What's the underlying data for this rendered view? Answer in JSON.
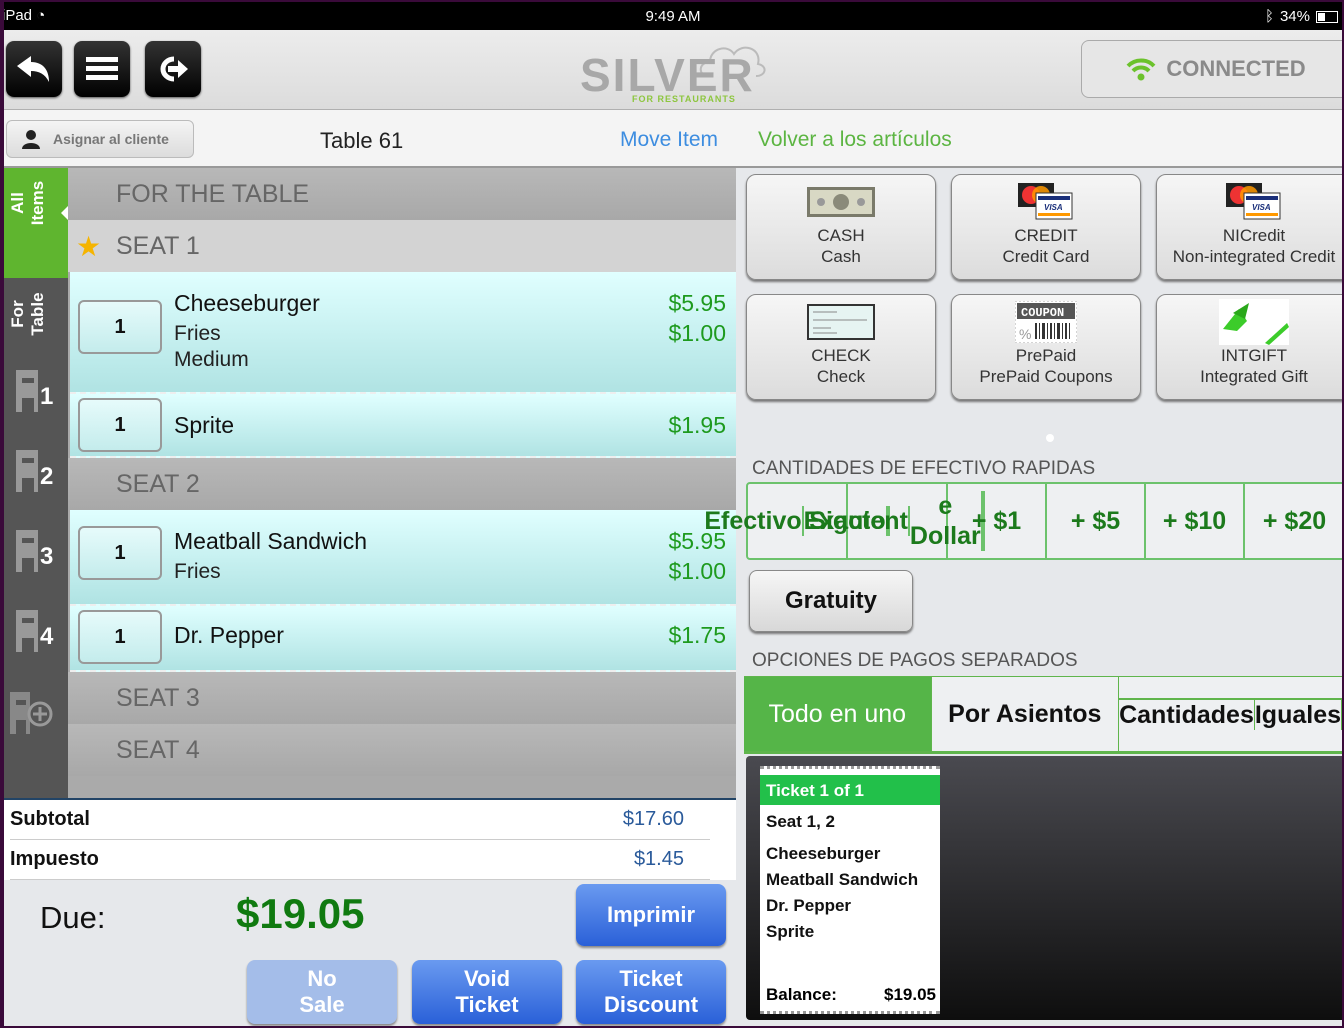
{
  "status_bar": {
    "device": "iPad",
    "time": "9:49 AM",
    "battery": "34%"
  },
  "header": {
    "logo_main": "SILVER",
    "logo_sub": "FOR RESTAURANTS",
    "connection_status": "CONNECTED",
    "back_icon": "back-arrow-icon",
    "menu_icon": "hamburger-menu-icon",
    "logout_icon": "logout-icon"
  },
  "subheader": {
    "assign_label": "Asignar al cliente",
    "table_name": "Table 61",
    "move_item": "Move Item",
    "back_to_items": "Volver a los artículos"
  },
  "side_tabs": {
    "all_items": [
      "All",
      "Items"
    ],
    "for_table": [
      "For",
      "Table"
    ],
    "seats": [
      "1",
      "2",
      "3",
      "4"
    ]
  },
  "order": {
    "sections": [
      {
        "title": "FOR THE TABLE",
        "items": []
      },
      {
        "title": "SEAT 1",
        "starred": true,
        "items": [
          {
            "qty": "1",
            "name": "Cheeseburger",
            "price": "$5.95",
            "modifiers": [
              {
                "name": "Fries",
                "price": "$1.00"
              },
              {
                "name": "Medium",
                "price": ""
              }
            ]
          },
          {
            "qty": "1",
            "name": "Sprite",
            "price": "$1.95",
            "modifiers": []
          }
        ]
      },
      {
        "title": "SEAT 2",
        "items": [
          {
            "qty": "1",
            "name": "Meatball Sandwich",
            "price": "$5.95",
            "modifiers": [
              {
                "name": "Fries",
                "price": "$1.00"
              }
            ]
          },
          {
            "qty": "1",
            "name": "Dr. Pepper",
            "price": "$1.75",
            "modifiers": []
          }
        ]
      },
      {
        "title": "SEAT 3",
        "items": []
      },
      {
        "title": "SEAT 4",
        "items": []
      }
    ]
  },
  "totals": {
    "subtotal_label": "Subtotal",
    "subtotal": "$17.60",
    "tax_label": "Impuesto",
    "tax": "$1.45",
    "due_label": "Due:",
    "due": "$19.05"
  },
  "actions": {
    "print": "Imprimir",
    "no_sale": [
      "No",
      "Sale"
    ],
    "void_ticket": [
      "Void",
      "Ticket"
    ],
    "ticket_discount": [
      "Ticket",
      "Discount"
    ]
  },
  "payment_methods": [
    {
      "code": "CASH",
      "label": "Cash",
      "icon": "dollar-bill-icon"
    },
    {
      "code": "CREDIT",
      "label": "Credit Card",
      "icon": "credit-cards-icon"
    },
    {
      "code": "NICredit",
      "label": "Non-integrated Credit",
      "icon": "credit-cards-icon"
    },
    {
      "code": "CHECK",
      "label": "Check",
      "icon": "check-icon"
    },
    {
      "code": "PrePaid",
      "label": "PrePaid Coupons",
      "icon": "coupon-icon"
    },
    {
      "code": "INTGIFT",
      "label": "Integrated Gift",
      "icon": "gift-ribbon-icon"
    }
  ],
  "quick_cash": {
    "title": "CANTIDADES DE EFECTIVO RAPIDAS",
    "options": [
      [
        "Efectivo",
        "Exacto"
      ],
      [
        "Siguient",
        "e Dollar"
      ],
      [
        "+ $1"
      ],
      [
        "+ $5"
      ],
      [
        "+ $10"
      ],
      [
        "+ $20"
      ]
    ]
  },
  "gratuity_label": "Gratuity",
  "split": {
    "title": "OPCIONES DE PAGOS SEPARADOS",
    "options": [
      [
        "Todo en uno"
      ],
      [
        "Por Asientos"
      ],
      [
        "Cantidades",
        "Iguales"
      ]
    ],
    "active_index": 0
  },
  "ticket": {
    "header": "Ticket 1 of 1",
    "seats": "Seat 1, 2",
    "items": [
      "Cheeseburger",
      "Meatball Sandwich",
      "Dr. Pepper",
      "Sprite"
    ],
    "balance_label": "Balance:",
    "balance": "$19.05"
  },
  "colors": {
    "accent_green": "#5fb52f",
    "price_green": "#1e9a1e",
    "button_blue": "#2a60d8",
    "ticket_green": "#22c04a"
  }
}
